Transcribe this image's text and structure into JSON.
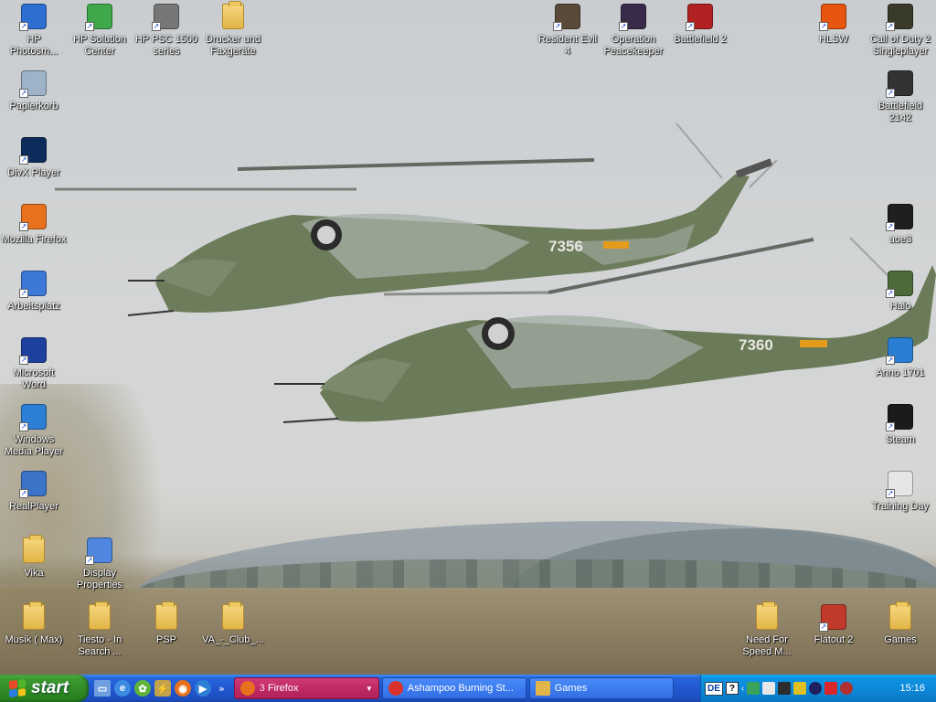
{
  "desktop": {
    "icons_left": [
      {
        "name": "hp-photosmart",
        "label": "HP\nPhotosm...",
        "color": "#2c6fd1"
      },
      {
        "name": "hp-solution-center",
        "label": "HP Solution\nCenter",
        "color": "#3ea84a"
      },
      {
        "name": "hp-psc-1500",
        "label": "HP PSC 1500\nseries",
        "color": "#777777"
      },
      {
        "name": "drucker-und-faxgeraete",
        "label": "Drucker und\nFaxgeräte",
        "color": "#e2b548"
      },
      {
        "name": "papierkorb",
        "label": "Papierkorb",
        "color": "#9fb3c8"
      },
      {
        "name": "divx-player",
        "label": "DivX Player",
        "color": "#0d2c5c"
      },
      {
        "name": "mozilla-firefox",
        "label": "Mozilla Firefox",
        "color": "#e8711d"
      },
      {
        "name": "arbeitsplatz",
        "label": "Arbeitsplatz",
        "color": "#3c78d8"
      },
      {
        "name": "microsoft-word",
        "label": "Microsoft\nWord",
        "color": "#1d3f9e"
      },
      {
        "name": "windows-media-player",
        "label": "Windows\nMedia Player",
        "color": "#2d7fd6"
      },
      {
        "name": "realplayer",
        "label": "RealPlayer",
        "color": "#3b73c9"
      },
      {
        "name": "vika",
        "label": "Vika",
        "color": "#e2b548"
      },
      {
        "name": "display-properties",
        "label": "Display\nProperties",
        "color": "#4f86e0"
      },
      {
        "name": "musik-max",
        "label": "Musik  ( Max)",
        "color": "#e2b548"
      },
      {
        "name": "tiesto-in-search",
        "label": "Tiesto - In\nSearch ...",
        "color": "#e2b548"
      },
      {
        "name": "psp",
        "label": "PSP",
        "color": "#e2b548"
      },
      {
        "name": "va-club",
        "label": "VA_-_Club_...",
        "color": "#e2b548"
      }
    ],
    "icons_right": [
      {
        "name": "resident-evil-4",
        "label": "Resident Evil\n4",
        "color": "#5a4a3a"
      },
      {
        "name": "operation-peacekeeper",
        "label": "Operation\nPeacekeeper",
        "color": "#3a2a4a"
      },
      {
        "name": "battlefield-2",
        "label": "Battlefield 2",
        "color": "#b22222"
      },
      {
        "name": "hlsw",
        "label": "HLSW",
        "color": "#e8550f"
      },
      {
        "name": "call-of-duty-2",
        "label": "Call of Duty 2\nSingleplayer",
        "color": "#3a3a2a"
      },
      {
        "name": "battlefield-2142",
        "label": "Battlefield\n2142",
        "color": "#333333"
      },
      {
        "name": "aoe3",
        "label": "aoe3",
        "color": "#1f1f1f"
      },
      {
        "name": "halo",
        "label": "Halo",
        "color": "#4d6b3a"
      },
      {
        "name": "anno-1701",
        "label": "Anno 1701",
        "color": "#2a7fd4"
      },
      {
        "name": "steam",
        "label": "Steam",
        "color": "#1b1b1b"
      },
      {
        "name": "training-day",
        "label": "Training Day",
        "color": "#e6e6e6"
      },
      {
        "name": "need-for-speed",
        "label": "Need For\nSpeed M...",
        "color": "#e2b548"
      },
      {
        "name": "flatout-2",
        "label": "Flatout 2",
        "color": "#c0392b"
      },
      {
        "name": "games-folder",
        "label": "Games",
        "color": "#e2b548"
      }
    ],
    "wallpaper": {
      "heli_1_number": "7356",
      "heli_2_number": "7360"
    }
  },
  "taskbar": {
    "start_label": "start",
    "quicklaunch": [
      "show-desktop",
      "internet-explorer",
      "icq",
      "winamp",
      "firefox",
      "media-player"
    ],
    "quicklaunch_more": "»",
    "tasks": [
      {
        "count": "3",
        "label": "Firefox",
        "active": true,
        "icon_color": "#e8711d"
      },
      {
        "count": "",
        "label": "Ashampoo Burning St...",
        "active": false,
        "icon_color": "#d9302a"
      },
      {
        "count": "",
        "label": "Games",
        "active": false,
        "icon_color": "#e2b548"
      }
    ],
    "tray": {
      "language": "DE",
      "help": "?",
      "clock": "15:16"
    }
  }
}
